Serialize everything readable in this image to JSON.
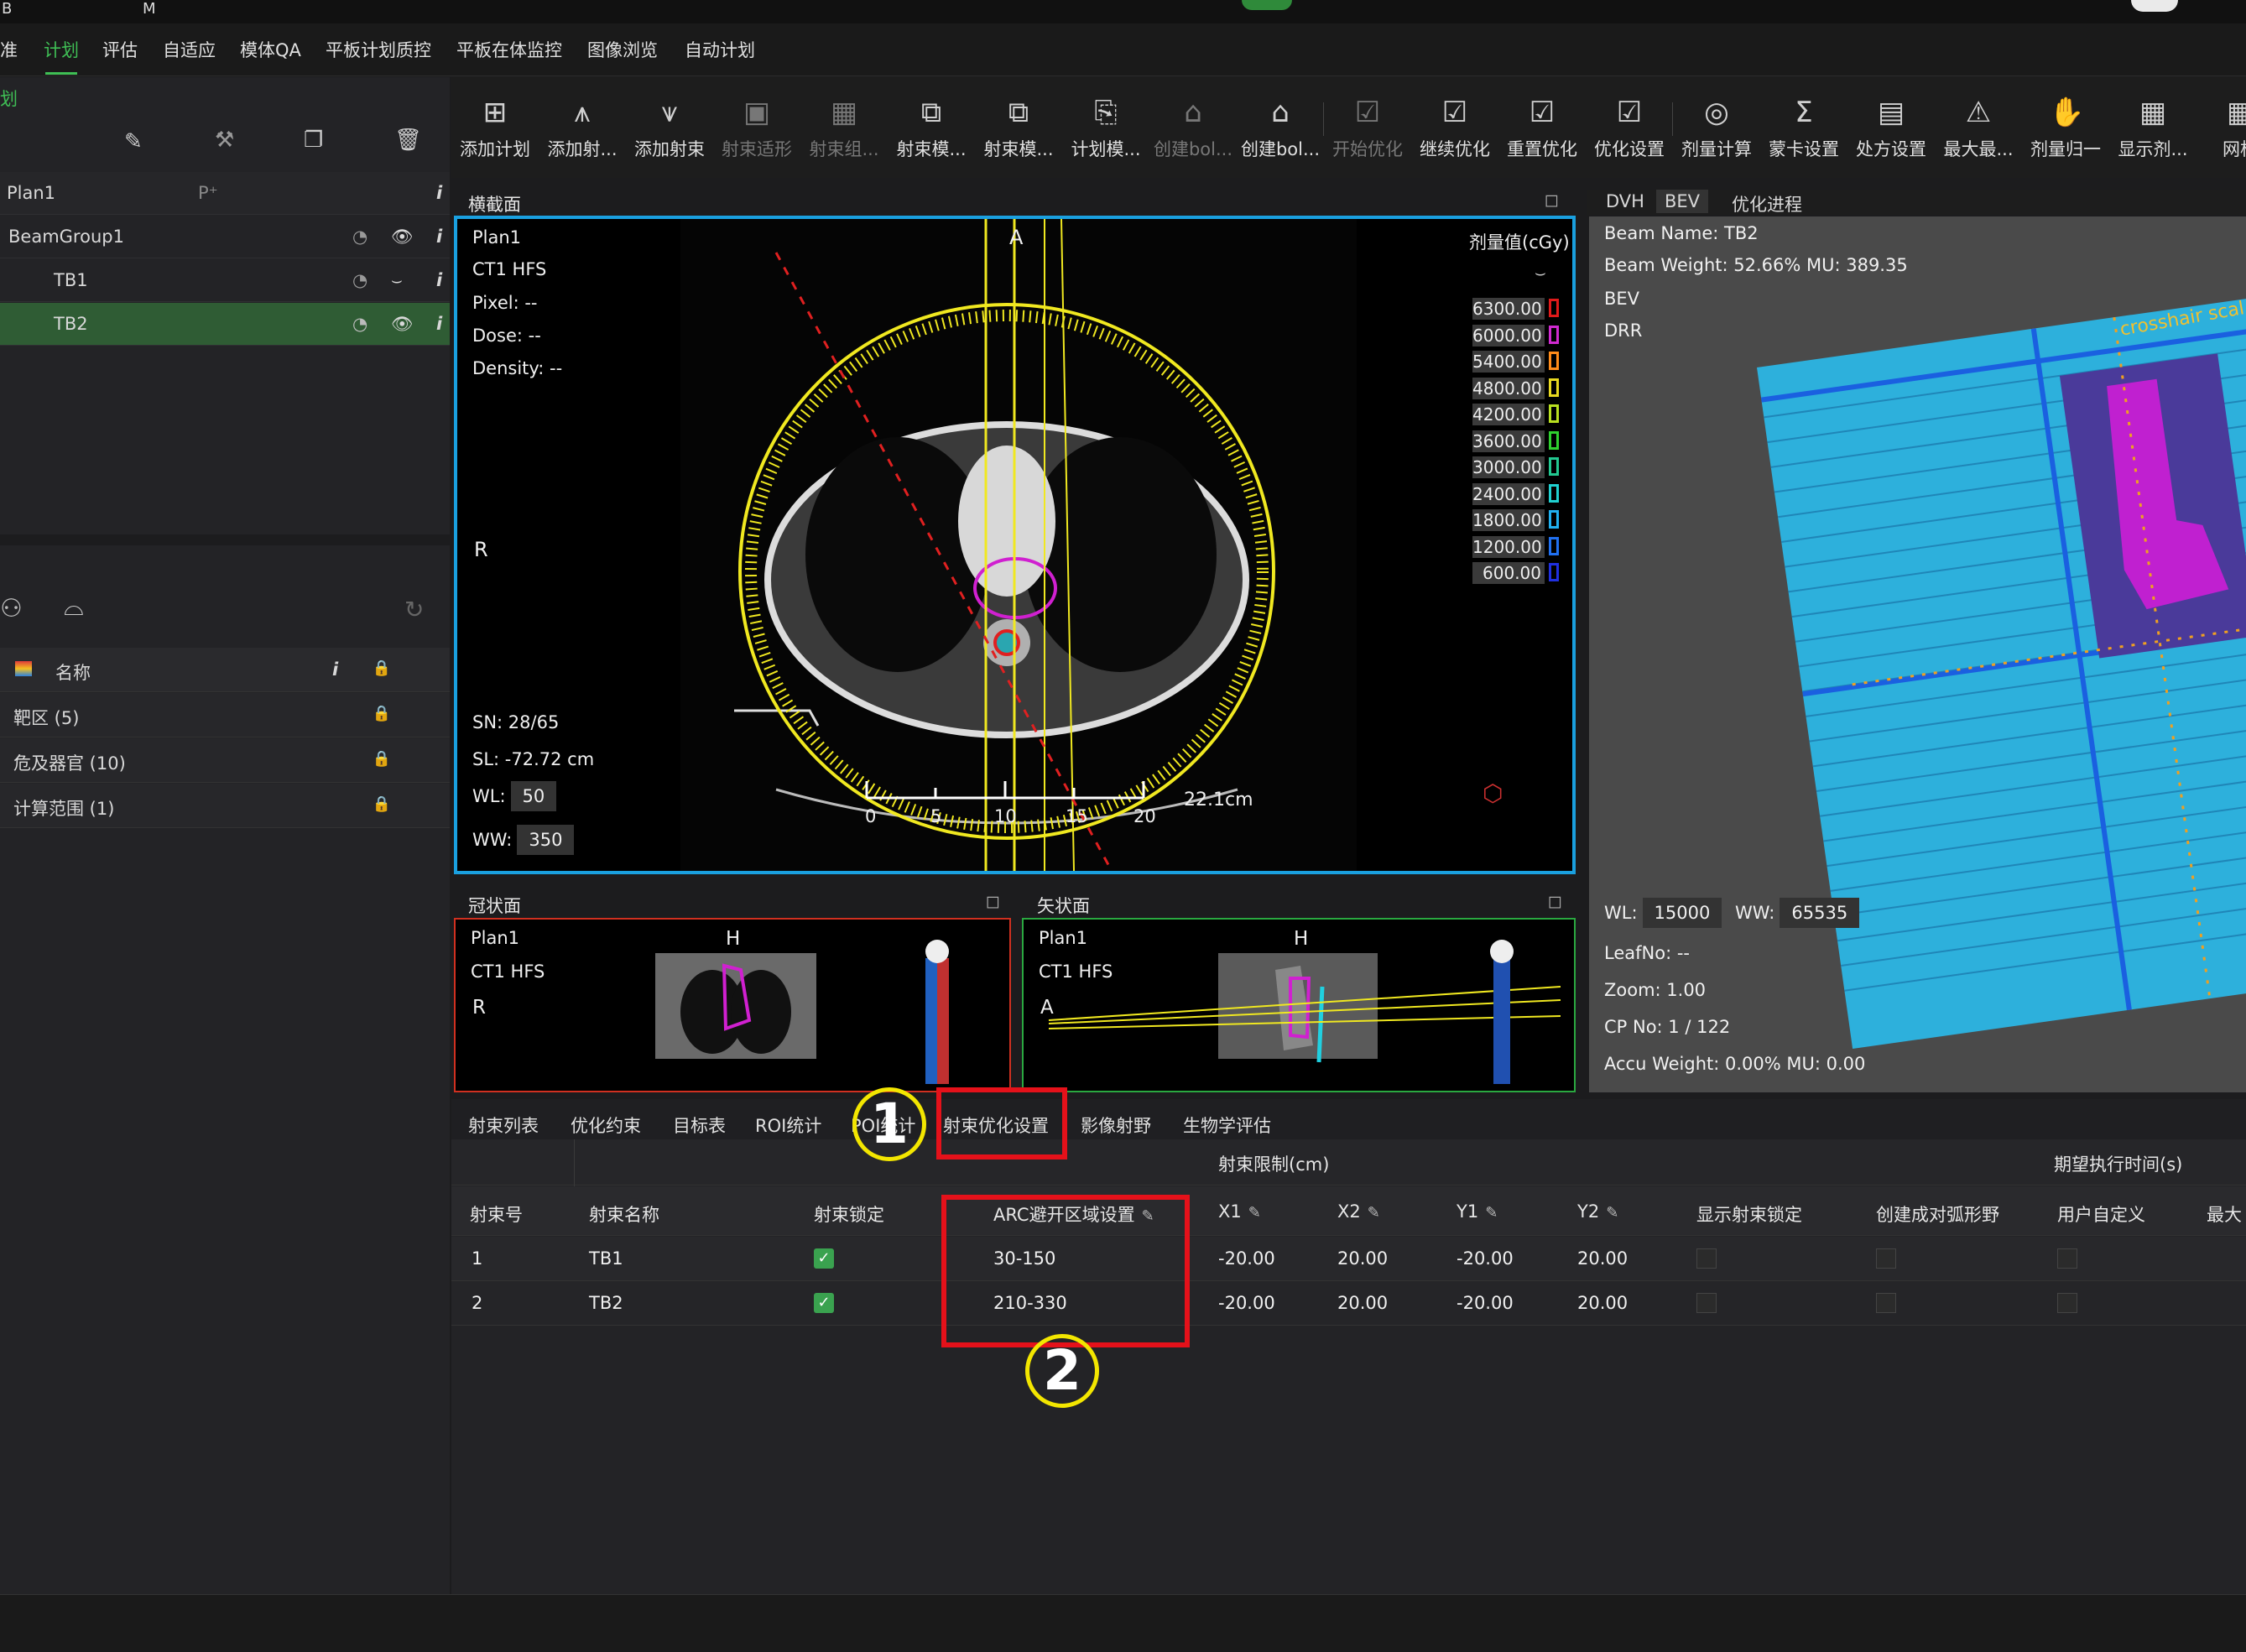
{
  "topbar": {
    "mark_b": "B",
    "mark_m": "M"
  },
  "menu": {
    "items": [
      "准",
      "计划",
      "评估",
      "自适应",
      "模体QA",
      "平板计划质控",
      "平板在体监控",
      "图像浏览",
      "自动计划"
    ],
    "active_index": 1,
    "accent_color": "#3fbf55",
    "side_tag": "划"
  },
  "toolbar": {
    "items": [
      {
        "label": "添加计划",
        "icon": "add-plan-icon"
      },
      {
        "label": "添加射...",
        "icon": "add-beam-icon"
      },
      {
        "label": "添加射束",
        "icon": "add-beam-icon"
      },
      {
        "label": "射束适形",
        "icon": "beam-conform-icon"
      },
      {
        "label": "射束组...",
        "icon": "beam-group-icon"
      },
      {
        "label": "射束模...",
        "icon": "beam-template-icon"
      },
      {
        "label": "射束模...",
        "icon": "beam-template-icon"
      },
      {
        "label": "计划模...",
        "icon": "plan-template-icon"
      },
      {
        "label": "创建bol...",
        "icon": "bolus-icon"
      },
      {
        "label": "创建bol...",
        "icon": "bolus-icon"
      },
      {
        "label": "开始优化",
        "icon": "start-optimize-icon"
      },
      {
        "label": "继续优化",
        "icon": "continue-optimize-icon"
      },
      {
        "label": "重置优化",
        "icon": "reset-optimize-icon"
      },
      {
        "label": "优化设置",
        "icon": "optimize-settings-icon"
      },
      {
        "label": "剂量计算",
        "icon": "dose-calc-icon"
      },
      {
        "label": "蒙卡设置",
        "icon": "monte-carlo-icon"
      },
      {
        "label": "处方设置",
        "icon": "prescription-icon"
      },
      {
        "label": "最大最...",
        "icon": "max-dose-icon"
      },
      {
        "label": "剂量归一",
        "icon": "dose-normalize-icon"
      },
      {
        "label": "显示剂...",
        "icon": "show-dose-icon"
      },
      {
        "label": "网格",
        "icon": "grid-icon"
      }
    ]
  },
  "plan_tree": {
    "plan": "Plan1",
    "group": "BeamGroup1",
    "beams": [
      "TB1",
      "TB2"
    ],
    "selected_beam": "TB2",
    "info_glyph": "i"
  },
  "roi_panel": {
    "header": "名称",
    "info_glyph": "i",
    "rows": [
      "靶区 (5)",
      "危及器官 (10)",
      "计算范围 (1)"
    ]
  },
  "transverse": {
    "title": "横截面",
    "plan": "Plan1",
    "ct": "CT1 HFS",
    "pixel": "Pixel: --",
    "dose": "Dose: --",
    "density": "Density: --",
    "orient_left": "R",
    "orient_top": "A",
    "sn": "SN: 28/65",
    "sl": "SL: -72.72 cm",
    "wl_label": "WL:",
    "wl": "50",
    "ww_label": "WW:",
    "ww": "350",
    "scale_label": "22.1cm",
    "scale_ticks": [
      "0",
      "5",
      "10",
      "15",
      "20"
    ],
    "legend_title": "剂量值(cGy)",
    "legend": [
      {
        "value": "6300.00",
        "color": "#e01a1a"
      },
      {
        "value": "6000.00",
        "color": "#d02ad0"
      },
      {
        "value": "5400.00",
        "color": "#ff8c1a"
      },
      {
        "value": "4800.00",
        "color": "#e8d820"
      },
      {
        "value": "4200.00",
        "color": "#b8e020"
      },
      {
        "value": "3600.00",
        "color": "#2fd02f"
      },
      {
        "value": "3000.00",
        "color": "#22c890"
      },
      {
        "value": "2400.00",
        "color": "#20d0d0"
      },
      {
        "value": "1800.00",
        "color": "#20b0f0"
      },
      {
        "value": "1200.00",
        "color": "#2070f0"
      },
      {
        "value": "600.00",
        "color": "#2030e0"
      }
    ]
  },
  "coronal": {
    "title": "冠状面",
    "plan": "Plan1",
    "ct": "CT1 HFS",
    "orient_left": "R",
    "orient_top": "H"
  },
  "sagittal": {
    "title": "矢状面",
    "plan": "Plan1",
    "ct": "CT1 HFS",
    "orient_left": "A",
    "orient_top": "H"
  },
  "bev": {
    "tabs": [
      "DVH",
      "BEV",
      "优化进程"
    ],
    "active_tab": 1,
    "beam_name": "Beam Name: TB2",
    "beam_weight": "Beam Weight: 52.66% MU: 389.35",
    "mode1": "BEV",
    "mode2": "DRR",
    "wl_label": "WL:",
    "wl": "15000",
    "ww_label": "WW:",
    "ww": "65535",
    "leaf": "LeafNo: --",
    "zoom": "Zoom: 1.00",
    "cp": "CP No: 1 / 122",
    "accu": "Accu Weight: 0.00% MU: 0.00",
    "crosshair_label": "crosshair scal"
  },
  "bottom_tabs": [
    "射束列表",
    "优化约束",
    "目标表",
    "ROI统计",
    "POI统计",
    "射束优化设置",
    "影像射野",
    "生物学评估"
  ],
  "table": {
    "group_header_limits": "射束限制(cm)",
    "group_header_time": "期望执行时间(s)",
    "headers": [
      "射束号",
      "射束名称",
      "射束锁定",
      "ARC避开区域设置",
      "X1",
      "X2",
      "Y1",
      "Y2",
      "显示射束锁定",
      "创建成对弧形野",
      "用户自定义",
      "最大"
    ],
    "rows": [
      {
        "num": "1",
        "name": "TB1",
        "locked": true,
        "arc": "30-150",
        "x1": "-20.00",
        "x2": "20.00",
        "y1": "-20.00",
        "y2": "20.00"
      },
      {
        "num": "2",
        "name": "TB2",
        "locked": true,
        "arc": "210-330",
        "x1": "-20.00",
        "x2": "20.00",
        "y1": "-20.00",
        "y2": "20.00"
      }
    ]
  },
  "annotations": {
    "step1": "1",
    "step2": "2",
    "highlight_color": "#e5111a",
    "circle_color": "#f3e600"
  }
}
